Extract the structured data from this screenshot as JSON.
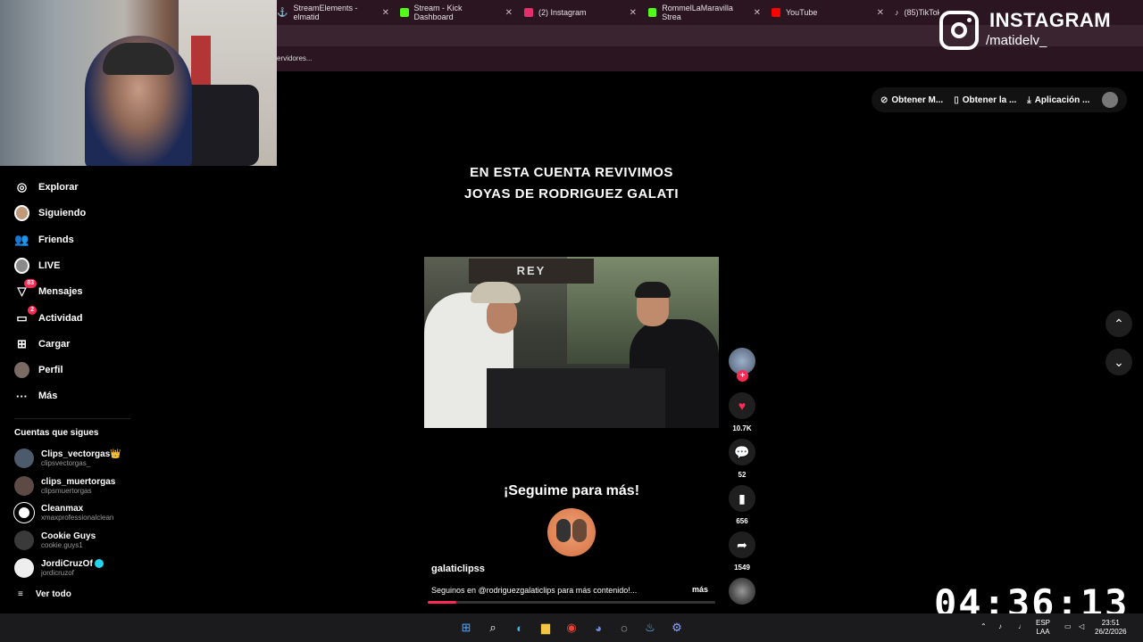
{
  "browser": {
    "tabs": [
      {
        "label": "StreamElements - elmatid",
        "color": "#ffffff"
      },
      {
        "label": "Stream - Kick Dashboard",
        "color": "#53fc18"
      },
      {
        "label": "(2) Instagram",
        "color": "#e1306c"
      },
      {
        "label": "RommelLaMaravilla Strea",
        "color": "#53fc18"
      },
      {
        "label": "YouTube",
        "color": "#ff0000"
      },
      {
        "label": "(85)TikTok - Make",
        "color": "#ffffff"
      }
    ],
    "bookmark_text": "ervidores..."
  },
  "overlay": {
    "instagram_title": "INSTAGRAM",
    "instagram_handle": "/matidelv_",
    "timer": "04:36:13"
  },
  "topbar": {
    "btn1": "Obtener M...",
    "btn2": "Obtener la ...",
    "btn3": "Aplicación ..."
  },
  "sidebar": {
    "items": [
      {
        "label": "Explorar",
        "icon": "compass-icon"
      },
      {
        "label": "Siguiendo",
        "icon": "avatar"
      },
      {
        "label": "Friends",
        "icon": "friends-icon"
      },
      {
        "label": "LIVE",
        "icon": "live-avatar"
      },
      {
        "label": "Mensajes",
        "icon": "messages-icon",
        "badge": "83"
      },
      {
        "label": "Actividad",
        "icon": "activity-icon",
        "badge": "2"
      },
      {
        "label": "Cargar",
        "icon": "upload-icon"
      },
      {
        "label": "Perfil",
        "icon": "profile-avatar"
      },
      {
        "label": "Más",
        "icon": "more-icon"
      }
    ],
    "following_header": "Cuentas que sigues",
    "following": [
      {
        "name": "Clips_vectorgas👑",
        "handle": "clipsvectorgas_",
        "verified": false
      },
      {
        "name": "clips_muertorgas",
        "handle": "clipsmuertorgas",
        "verified": false
      },
      {
        "name": "Cleanmax",
        "handle": "xmaxprofessionalclean",
        "verified": false
      },
      {
        "name": "Cookie Guys",
        "handle": "cookie.guys1",
        "verified": false
      },
      {
        "name": "JordiCruzOf",
        "handle": "jordicruzof",
        "verified": true
      }
    ],
    "view_all": "Ver todo"
  },
  "video": {
    "caption_line1": "EN ESTA CUENTA REVIVIMOS",
    "caption_line2": "JOYAS DE RODRIGUEZ GALATI",
    "sign_text": "REY",
    "cta": "¡Seguime para más!",
    "author": "galaticlipss",
    "description": "Seguinos en @rodriguezgalaticlips para más contenido!...",
    "more": "más",
    "progress": 0.1
  },
  "actions": {
    "likes": "10.7K",
    "comments": "52",
    "saves": "656",
    "shares": "1549"
  },
  "taskbar": {
    "lang1": "ESP",
    "lang2": "LAA",
    "time": "23:51",
    "date": "26/2/2026"
  }
}
